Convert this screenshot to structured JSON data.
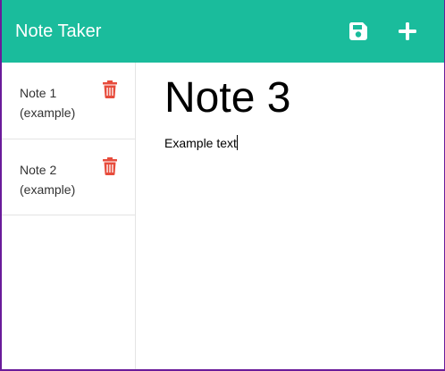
{
  "navbar": {
    "brand": "Note Taker",
    "save_icon": "floppy-disk-icon",
    "add_icon": "plus-icon",
    "background": "#1abc9c"
  },
  "sidebar": {
    "notes": [
      {
        "title": "Note 1 (example)",
        "delete_icon": "trash-icon"
      },
      {
        "title": "Note 2 (example)",
        "delete_icon": "trash-icon"
      }
    ],
    "delete_color": "#e74c3c"
  },
  "editor": {
    "title": "Note 3",
    "text": "Example text"
  }
}
